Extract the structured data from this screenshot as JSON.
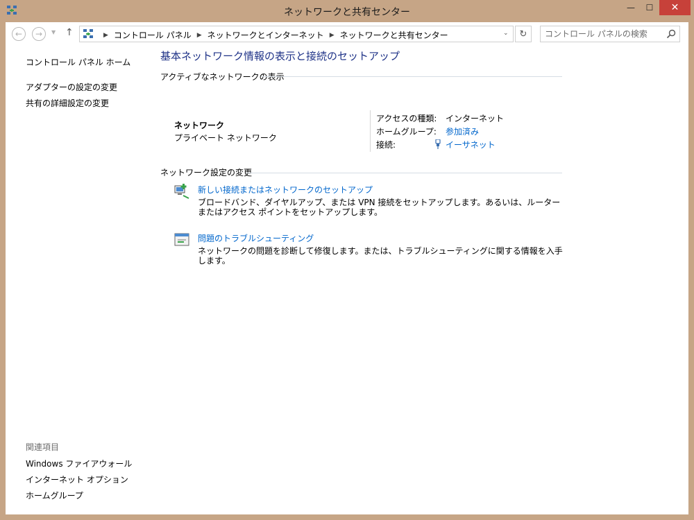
{
  "window": {
    "title": "ネットワークと共有センター",
    "close_glyph": "✕",
    "min_glyph": "—",
    "max_glyph": "☐"
  },
  "navbar": {
    "back_glyph": "←",
    "forward_glyph": "→",
    "dropdown_glyph": "▼",
    "up_glyph": "↑",
    "breadcrumbs": [
      "コントロール パネル",
      "ネットワークとインターネット",
      "ネットワークと共有センター"
    ],
    "breadcrumb_separator": "▶",
    "address_dropdown_glyph": "⌄",
    "refresh_glyph": "↻",
    "search_placeholder": "コントロール パネルの検索"
  },
  "sidebar": {
    "home": "コントロール パネル ホーム",
    "tasks": [
      "アダプターの設定の変更",
      "共有の詳細設定の変更"
    ],
    "related_heading": "関連項目",
    "related": [
      "Windows ファイアウォール",
      "インターネット オプション",
      "ホームグループ"
    ]
  },
  "main": {
    "title": "基本ネットワーク情報の表示と接続のセットアップ",
    "active_networks_heading": "アクティブなネットワークの表示",
    "network": {
      "name": "ネットワーク",
      "type": "プライベート ネットワーク",
      "access_type_label": "アクセスの種類:",
      "access_type_value": "インターネット",
      "homegroup_label": "ホームグループ:",
      "homegroup_value": "参加済み",
      "connections_label": "接続:",
      "connections_value": "イーサネット"
    },
    "change_settings_heading": "ネットワーク設定の変更",
    "tasks": [
      {
        "title": "新しい接続またはネットワークのセットアップ",
        "description": "ブロードバンド、ダイヤルアップ、または VPN 接続をセットアップします。あるいは、ルーターまたはアクセス ポイントをセットアップします。"
      },
      {
        "title": "問題のトラブルシューティング",
        "description": "ネットワークの問題を診断して修復します。または、トラブルシューティングに関する情報を入手します。"
      }
    ]
  },
  "colors": {
    "frame": "#c6a586",
    "close_button": "#c7413a",
    "title_blue": "#1e3287",
    "link_blue": "#0066cc"
  }
}
